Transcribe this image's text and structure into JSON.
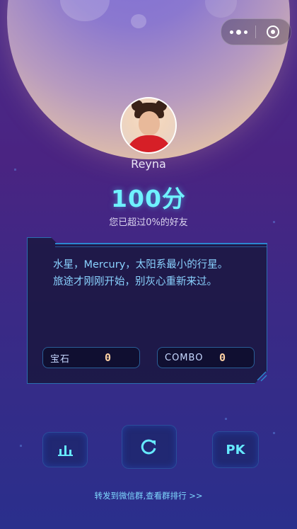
{
  "header": {
    "capsule": {
      "more_icon": "more-dots-icon",
      "close_icon": "target-close-icon"
    }
  },
  "profile": {
    "avatar_icon": "avatar",
    "username": "Reyna"
  },
  "result": {
    "score": "100分",
    "percent_text": "您已超过0%的好友"
  },
  "message_card": {
    "line1": "水星，Mercury，太阳系最小的行星。",
    "line2": "旅途才刚刚开始，别灰心重新来过。",
    "stats": [
      {
        "label": "宝石",
        "value": "0"
      },
      {
        "label": "COMBO",
        "value": "0"
      }
    ]
  },
  "actions": {
    "rank_icon": "bar-chart-icon",
    "replay_icon": "replay-icon",
    "pk_label": "PK"
  },
  "footer": {
    "share_text": "转发到微信群,查看群排行 >>"
  },
  "colors": {
    "accent": "#6ff2ff",
    "card_text": "#8ad2ff",
    "stat_value": "#ffd2a4"
  }
}
